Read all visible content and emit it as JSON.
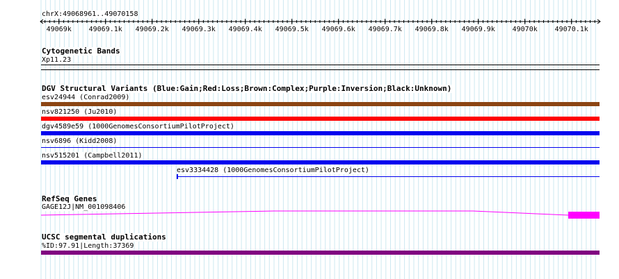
{
  "ruler": {
    "region": "chrX:49068961..49070158",
    "ticks": [
      "49069k",
      "49069.1k",
      "49069.2k",
      "49069.3k",
      "49069.4k",
      "49069.5k",
      "49069.6k",
      "49069.7k",
      "49069.8k",
      "49069.9k",
      "49070k",
      "49070.1k"
    ]
  },
  "cytobands": {
    "title": "Cytogenetic Bands",
    "band": "Xp11.23"
  },
  "dgv": {
    "title": "DGV Structural Variants (Blue:Gain;Red:Loss;Brown:Complex;Purple:Inversion;Black:Unknown)",
    "features": [
      {
        "label": "esv24944 (Conrad2009)",
        "color": "#8b4513",
        "style": "thick"
      },
      {
        "label": "nsv821250 (Ju2010)",
        "color": "#ff0000",
        "style": "thick"
      },
      {
        "label": "dgv4589e59 (1000GenomesConsortiumPilotProject)",
        "color": "#0000ee",
        "style": "thick"
      },
      {
        "label": "nsv6896 (Kidd2008)",
        "color": "#0000ee",
        "style": "thin"
      },
      {
        "label": "nsv515201 (Campbell2011)",
        "color": "#0000ee",
        "style": "thick"
      },
      {
        "label": "esv3334428 (1000GenomesConsortiumPilotProject)",
        "color": "#0000ee",
        "style": "thin"
      }
    ]
  },
  "refseq": {
    "title": "RefSeq Genes",
    "gene": "GAGE12J|NM_001098406",
    "color": "#ff00ff"
  },
  "segdup": {
    "title": "UCSC segmental duplications",
    "label": "%ID:97.91|Length:37369",
    "color": "#800080"
  }
}
